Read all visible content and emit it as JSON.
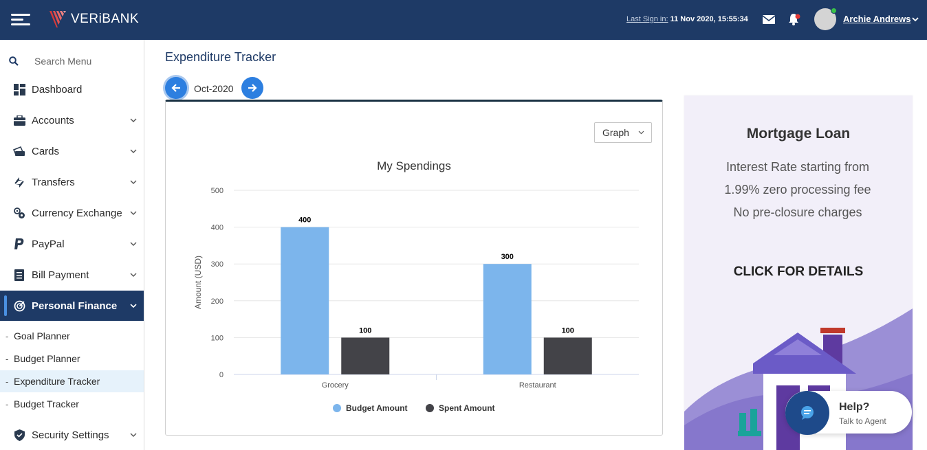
{
  "header": {
    "brand": "VERiBANK",
    "last_signin_label": "Last Sign in:",
    "last_signin_value": " 11 Nov 2020, 15:55:34",
    "username": "Archie Andrews"
  },
  "sidebar": {
    "search_placeholder": "Search Menu",
    "items": [
      {
        "label": "Dashboard",
        "icon": "dashboard-icon"
      },
      {
        "label": "Accounts",
        "icon": "briefcase-icon"
      },
      {
        "label": "Cards",
        "icon": "credit-card-icon"
      },
      {
        "label": "Transfers",
        "icon": "transfer-icon"
      },
      {
        "label": "Currency Exchange",
        "icon": "currency-exchange-icon"
      },
      {
        "label": "PayPal",
        "icon": "paypal-icon"
      },
      {
        "label": "Bill Payment",
        "icon": "bill-icon"
      },
      {
        "label": "Personal Finance",
        "icon": "target-icon"
      },
      {
        "label": "Security Settings",
        "icon": "shield-icon"
      }
    ],
    "sub_items": [
      "Goal Planner",
      "Budget Planner",
      "Expenditure Tracker",
      "Budget Tracker"
    ]
  },
  "main": {
    "title": "Expenditure Tracker",
    "month": "Oct-2020",
    "view_select": "Graph"
  },
  "chart_data": {
    "type": "bar",
    "title": "My Spendings",
    "ylabel": "Amount (USD)",
    "xlabel": "",
    "categories": [
      "Grocery",
      "Restaurant"
    ],
    "ylim": [
      0,
      500
    ],
    "yticks": [
      "0",
      "100",
      "200",
      "300",
      "400",
      "500"
    ],
    "series": [
      {
        "name": "Budget Amount",
        "values": [
          400,
          300
        ],
        "color": "#7cb5ec"
      },
      {
        "name": "Spent Amount",
        "values": [
          100,
          100
        ],
        "color": "#434348"
      }
    ],
    "grid": true,
    "legend": "bottom"
  },
  "ad": {
    "title": "Mortgage Loan",
    "description": "Interest Rate starting from 1.99% zero processing fee No pre-closure charges",
    "cta": "CLICK FOR DETAILS"
  },
  "help": {
    "title": "Help?",
    "subtitle": "Talk to Agent"
  },
  "colors": {
    "header_bg": "#1e3a66",
    "accent_blue": "#2d7fe0",
    "budget": "#7cb5ec",
    "spent": "#434348",
    "active_sub_bg": "#e6f2fb"
  }
}
